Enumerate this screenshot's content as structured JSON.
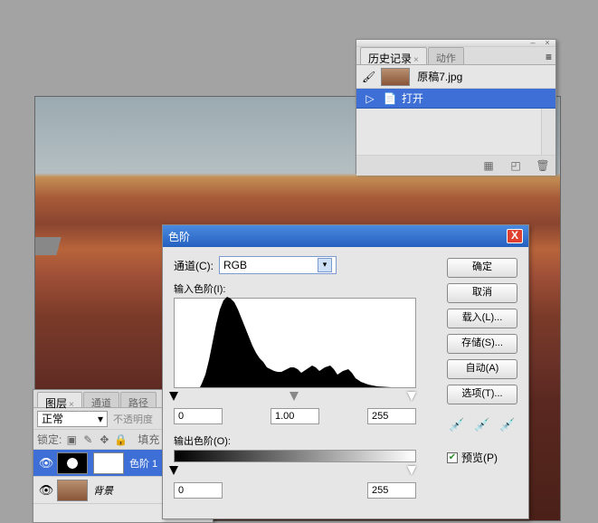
{
  "history": {
    "tabs": [
      "历史记录",
      "动作"
    ],
    "snapshot": "原稿7.jpg",
    "state": "打开"
  },
  "layers": {
    "tabs": [
      "图层",
      "通道",
      "路径"
    ],
    "blendMode": "正常",
    "opacityLabel": "不透明度",
    "lockLabel": "锁定:",
    "fillLabel": "填充",
    "items": [
      {
        "name": "色阶 1",
        "selected": true
      },
      {
        "name": "背景",
        "selected": false
      }
    ]
  },
  "levels": {
    "title": "色阶",
    "channelLabel": "通道(C):",
    "channel": "RGB",
    "inputLabel": "输入色阶(I):",
    "outputLabel": "输出色阶(O):",
    "inBlack": "0",
    "inGamma": "1.00",
    "inWhite": "255",
    "outBlack": "0",
    "outWhite": "255",
    "buttons": {
      "ok": "确定",
      "cancel": "取消",
      "load": "载入(L)...",
      "save": "存储(S)...",
      "auto": "自动(A)",
      "options": "选项(T)..."
    },
    "preview": "预览(P)"
  },
  "chart_data": {
    "type": "histogram",
    "title": "输入色阶",
    "xlabel": "",
    "ylabel": "",
    "x_range": [
      0,
      255
    ],
    "values": [
      0,
      0,
      0,
      0,
      0,
      0,
      0,
      0,
      0,
      0,
      0,
      0,
      0,
      0,
      0,
      0,
      0,
      0,
      0,
      0,
      0,
      0,
      0,
      0,
      0,
      0,
      0,
      0,
      1,
      2,
      4,
      8,
      14,
      22,
      32,
      44,
      58,
      70,
      80,
      88,
      94,
      98,
      100,
      99,
      97,
      94,
      90,
      86,
      80,
      74,
      68,
      60,
      54,
      48,
      42,
      36,
      32,
      28,
      24,
      22,
      20,
      18,
      17,
      16,
      15,
      15,
      14,
      14,
      13,
      13,
      12,
      12,
      12,
      11,
      11,
      10,
      10,
      10,
      9,
      9,
      9,
      10,
      10,
      10,
      11,
      12,
      12,
      12,
      11,
      10,
      9,
      9,
      8,
      8,
      8,
      9,
      10,
      11,
      12,
      12,
      11,
      10,
      9,
      8,
      7,
      7,
      7,
      8,
      9,
      10,
      11,
      11,
      10,
      9,
      8,
      7,
      6,
      5,
      5,
      4,
      4,
      3,
      3,
      2,
      2,
      1,
      1,
      1,
      0,
      0,
      0,
      0,
      0,
      0,
      0,
      0,
      0,
      0,
      0,
      0,
      0,
      0,
      0,
      0,
      0,
      0,
      0,
      0,
      0,
      0,
      0,
      0,
      0,
      0,
      0,
      0,
      0,
      0,
      0,
      0,
      0,
      0,
      0,
      0,
      0,
      0,
      0,
      0,
      0,
      0,
      0,
      0,
      0,
      0,
      0,
      0,
      0,
      0,
      0,
      0,
      0,
      0,
      0,
      0,
      0,
      0,
      0,
      0,
      0,
      0,
      0,
      0,
      0,
      0,
      0,
      0,
      0,
      0,
      0,
      0,
      0,
      0,
      0,
      0,
      0,
      0,
      0,
      0,
      0,
      0,
      0,
      0,
      0,
      0,
      0,
      0,
      0,
      0,
      0,
      0,
      0,
      0,
      0,
      0,
      0,
      0,
      0,
      0,
      0,
      0,
      0,
      0,
      0,
      0,
      0,
      0,
      0,
      0,
      0,
      0,
      0,
      0,
      0,
      0,
      0,
      0,
      0,
      0,
      0,
      0,
      0,
      0,
      0,
      0,
      0,
      0
    ]
  }
}
